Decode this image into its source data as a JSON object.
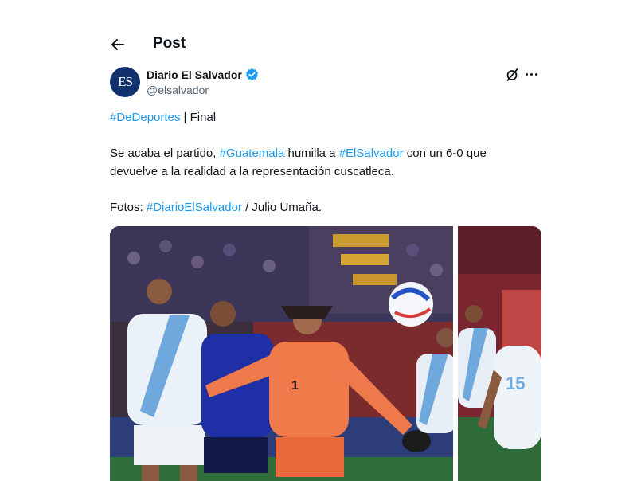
{
  "header": {
    "title": "Post",
    "back_icon": "arrow-left-icon"
  },
  "author": {
    "avatar_text": "ES",
    "name": "Diario El Salvador",
    "handle": "@elsalvador",
    "verified_icon": "verified-badge-icon",
    "verified_color": "#1d9bf0"
  },
  "actions": {
    "grok_icon": "grok-icon",
    "more_icon": "more-horizontal-icon"
  },
  "tweet": {
    "line1": {
      "hashtag": "#DeDeportes",
      "rest": " | Final"
    },
    "line2": {
      "t1": "Se acaba el partido, ",
      "h1": "#Guatemala",
      "t2": " humilla a ",
      "h2": "#ElSalvador",
      "t3": " con un 6-0 que"
    },
    "line3": "devuelve a la realidad a la representación cuscatleca.",
    "line4": {
      "t1": "Fotos: ",
      "h1": "#DiarioElSalvador",
      "t2": " / Julio Umaña."
    }
  },
  "colors": {
    "link": "#1d9bf0",
    "text": "#0f1419",
    "muted": "#536471"
  }
}
